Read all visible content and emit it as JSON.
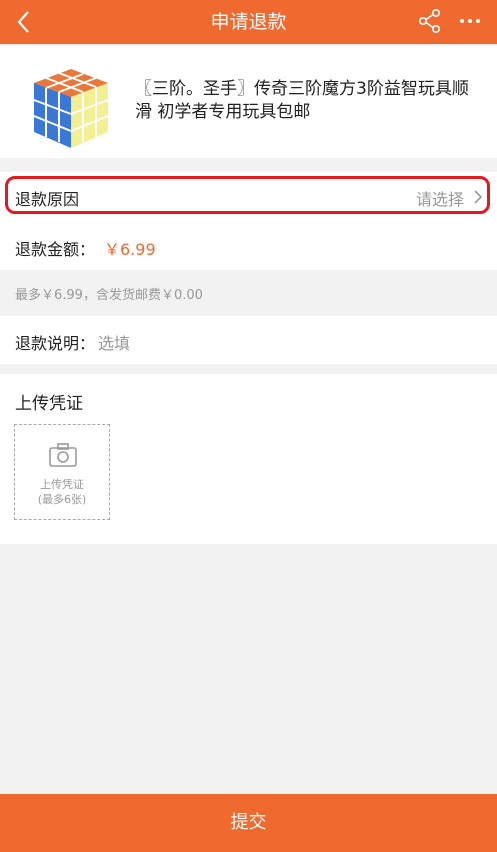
{
  "header": {
    "title": "申请退款"
  },
  "product": {
    "title": "〖三阶。圣手〗传奇三阶魔方3阶益智玩具顺滑 初学者专用玩具包邮"
  },
  "refund_reason": {
    "label": "退款原因",
    "placeholder": "请选择"
  },
  "refund_amount": {
    "label": "退款金额：",
    "value": "￥6.99"
  },
  "amount_note": "最多￥6.99，含发货邮费￥0.00",
  "refund_description": {
    "label": "退款说明：",
    "placeholder": "选填"
  },
  "upload": {
    "title": "上传凭证",
    "line1": "上传凭证",
    "line2": "(最多6张)"
  },
  "submit_label": "提交",
  "colors": {
    "accent": "#f0692f",
    "highlight": "#e8161f"
  }
}
